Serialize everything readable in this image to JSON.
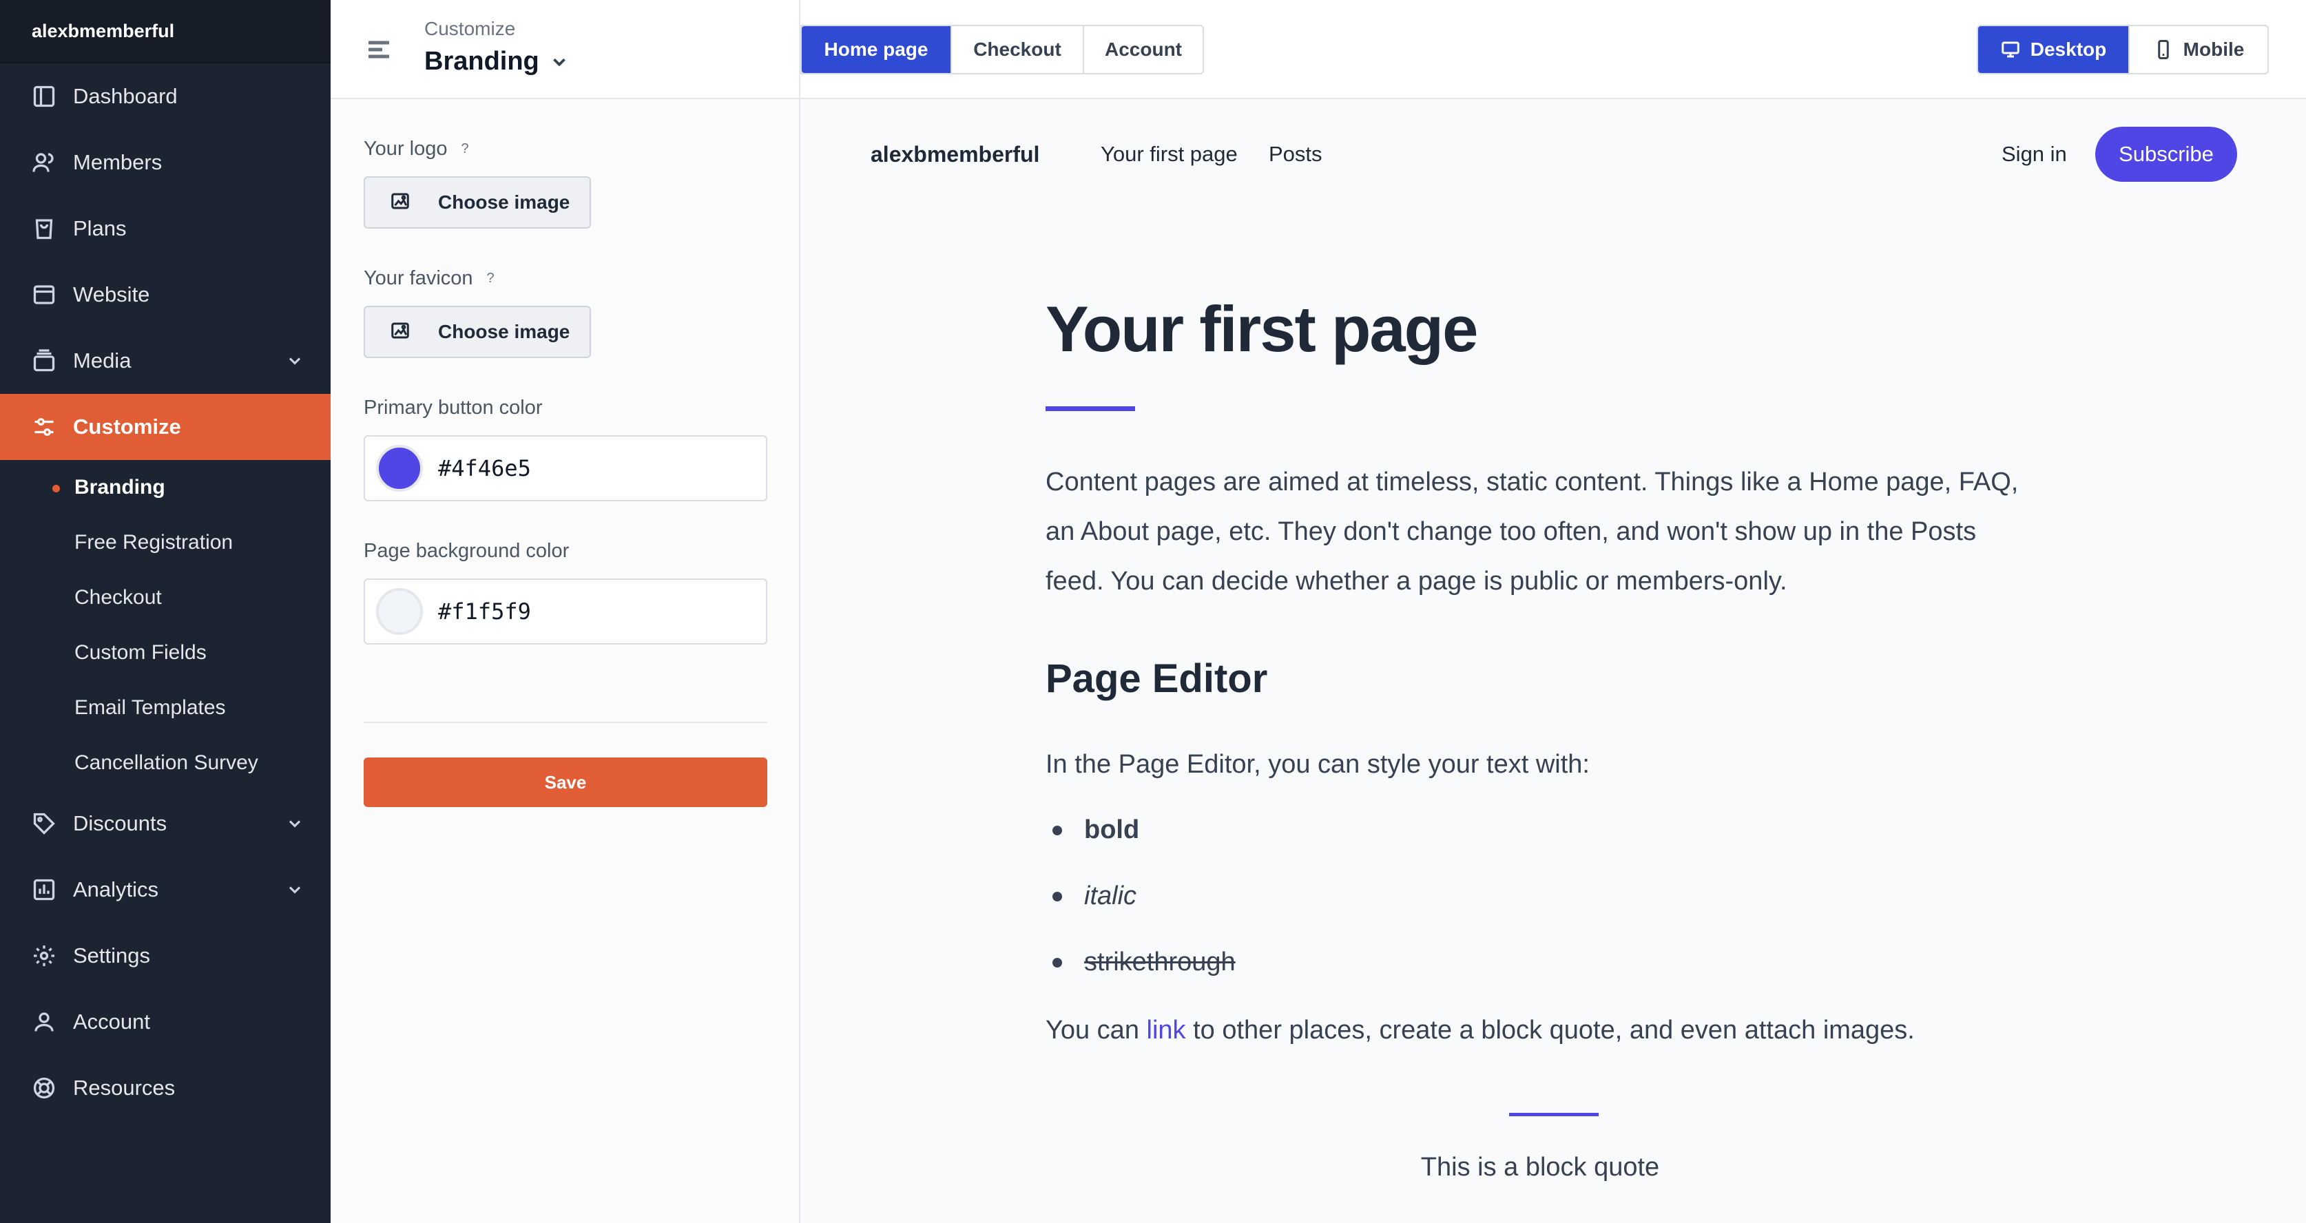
{
  "sidebar": {
    "account_name": "alexbmemberful",
    "items": [
      {
        "label": "Dashboard"
      },
      {
        "label": "Members"
      },
      {
        "label": "Plans"
      },
      {
        "label": "Website"
      },
      {
        "label": "Media"
      },
      {
        "label": "Customize"
      },
      {
        "label": "Discounts"
      },
      {
        "label": "Analytics"
      },
      {
        "label": "Settings"
      },
      {
        "label": "Account"
      },
      {
        "label": "Resources"
      }
    ],
    "customize_sub": [
      {
        "label": "Branding"
      },
      {
        "label": "Free Registration"
      },
      {
        "label": "Checkout"
      },
      {
        "label": "Custom Fields"
      },
      {
        "label": "Email Templates"
      },
      {
        "label": "Cancellation Survey"
      }
    ]
  },
  "panel": {
    "eyebrow": "Customize",
    "title": "Branding",
    "logo_label": "Your logo",
    "favicon_label": "Your favicon",
    "help_mark": "?",
    "choose_image": "Choose image",
    "primary_label": "Primary button color",
    "primary_value": "#4f46e5",
    "background_label": "Page background color",
    "background_value": "#f1f5f9",
    "save": "Save"
  },
  "topbar": {
    "page_tabs": [
      "Home page",
      "Checkout",
      "Account"
    ],
    "active_page_tab": "Home page",
    "devices": [
      "Desktop",
      "Mobile"
    ],
    "active_device": "Desktop"
  },
  "preview": {
    "brand": "alexbmemberful",
    "nav": [
      "Your first page",
      "Posts"
    ],
    "sign_in": "Sign in",
    "subscribe": "Subscribe",
    "heading": "Your first page",
    "para1_lines": [
      "Content pages are aimed at timeless, static content. Things like a Home page, FAQ,",
      "an About page, etc. They don't change too often, and won't show up in the Posts",
      "feed. You can decide whether a page is public or members-only."
    ],
    "subheading": "Page Editor",
    "para2": "In the Page Editor, you can style your text with:",
    "list": [
      "bold",
      "italic",
      "strikethrough"
    ],
    "para3_before": "You can ",
    "para3_link": "link",
    "para3_after": " to other places, create a block quote, and even attach images.",
    "blockquote": "This is a block quote"
  },
  "colors": {
    "sidebar_bg": "#1c2331",
    "accent": "#e05d36",
    "primary": "#4f46e5",
    "tab_active": "#2f4ad3"
  }
}
